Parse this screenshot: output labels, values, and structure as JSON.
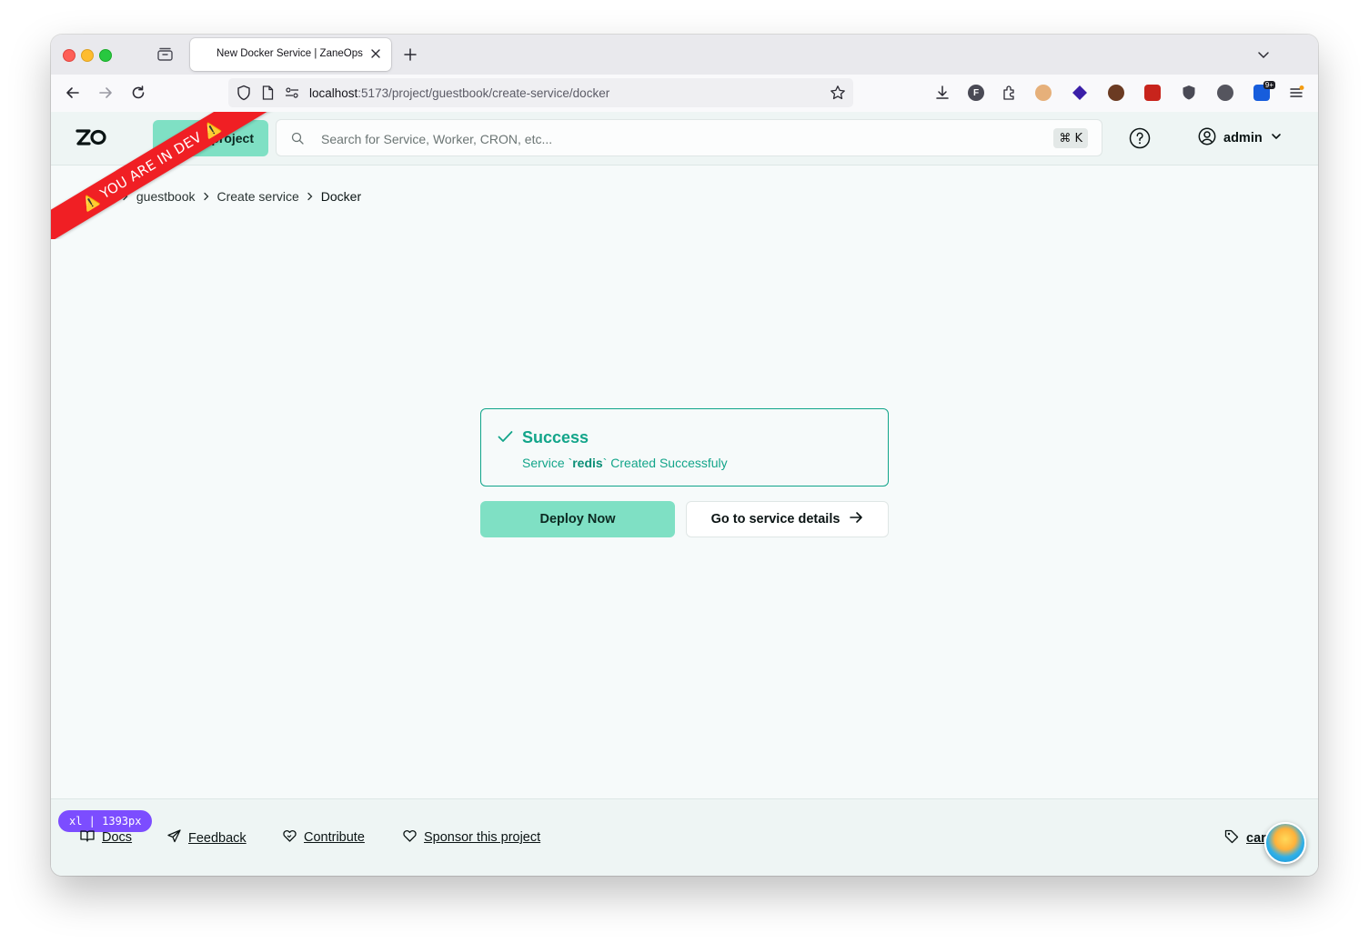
{
  "browser": {
    "tab_title": "New Docker Service | ZaneOps",
    "url_host": "localhost",
    "url_path": ":5173/project/guestbook/create-service/docker",
    "extension_badge": "9+"
  },
  "header": {
    "new_project_label": "project",
    "search_placeholder": "Search for Service, Worker, CRON, etc...",
    "shortcut": "⌘ K",
    "user_name": "admin"
  },
  "dev_ribbon": "⚠️ YOU ARE IN DEV ⚠️",
  "breadcrumb": {
    "items": [
      "cts",
      "guestbook",
      "Create service"
    ],
    "current": "Docker"
  },
  "alert": {
    "title": "Success",
    "desc_prefix": "Service `",
    "desc_service": "redis",
    "desc_suffix": "` Created Successfuly"
  },
  "actions": {
    "deploy_label": "Deploy Now",
    "details_label": "Go to service details"
  },
  "footer": {
    "breakpoint": "xl | 1393px",
    "docs": "Docs",
    "feedback": "Feedback",
    "contribute": "Contribute",
    "sponsor": "Sponsor this project",
    "version": "car"
  },
  "colors": {
    "accent": "#7fe0c4",
    "success": "#13a58a",
    "ribbon": "#f01f24",
    "badge": "#7c4dff"
  }
}
